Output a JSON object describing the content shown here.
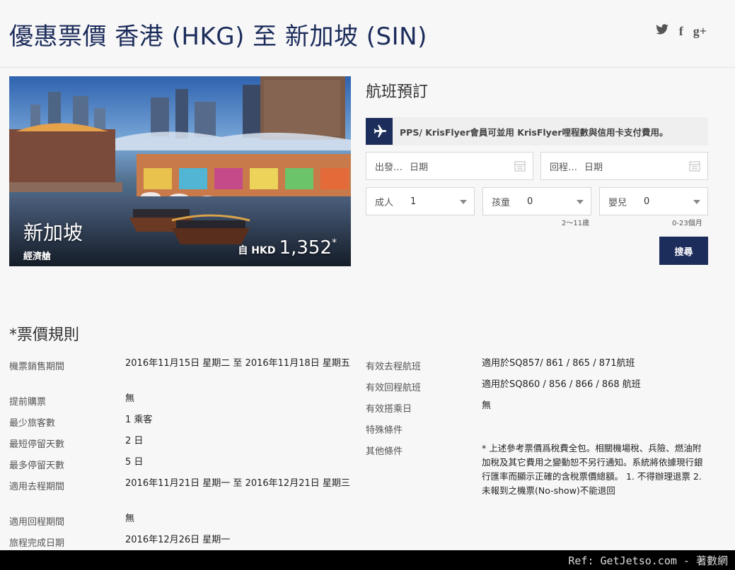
{
  "page": {
    "title": "優惠票價 香港 (HKG) 至 新加坡 (SIN)"
  },
  "social": {
    "twitter": "🐦",
    "facebook": "f",
    "googleplus": "g+"
  },
  "hero": {
    "destination": "新加坡",
    "cabin_class": "經濟艙",
    "price_prefix": "自 HKD",
    "price": "1,352",
    "price_mark": "*"
  },
  "booking": {
    "title": "航班預訂",
    "notice": "PPS/ KrisFlyer會員可並用 KrisFlyer哩程數與信用卡支付費用。",
    "depart_label": "出發…",
    "depart_placeholder": "日期",
    "return_label": "回程…",
    "return_placeholder": "日期",
    "adults_label": "成人",
    "adults_value": "1",
    "children_label": "孩童",
    "children_value": "0",
    "children_hint": "2～11歲",
    "infants_label": "嬰兒",
    "infants_value": "0",
    "infants_hint": "0-23個月",
    "search_label": "搜尋"
  },
  "rules": {
    "title": "*票價規則",
    "left": [
      {
        "label": "機票銷售期間",
        "value": "2016年11月15日 星期二 至 2016年11月18日 星期五"
      },
      {
        "label": "提前購票",
        "value": "無"
      },
      {
        "label": "最少旅客數",
        "value": "1 乘客"
      },
      {
        "label": "最短停留天數",
        "value": "2 日"
      },
      {
        "label": "最多停留天數",
        "value": "5 日"
      },
      {
        "label": "適用去程期間",
        "value": "2016年11月21日 星期一 至 2016年12月21日 星期三"
      },
      {
        "label": "適用回程期間",
        "value": "無"
      },
      {
        "label": "旅程完成日期",
        "value": "2016年12月26日 星期一"
      }
    ],
    "right": [
      {
        "label": "有效去程航班",
        "value": "適用於SQ857/ 861 / 865 / 871航班"
      },
      {
        "label": "有效回程航班",
        "value": "適用於SQ860 / 856 / 866 / 868 航班"
      },
      {
        "label": "有效搭乘日",
        "value": "無"
      },
      {
        "label": "特殊條件",
        "value": ""
      },
      {
        "label": "其他條件",
        "value": "* 上述參考票價爲稅費全包。相關機場稅、兵險、燃油附加稅及其它費用之變動恕不另行通知。系統將依據現行銀行匯率而顯示正確的含稅票價總額。 1. 不得辦理退票 2. 未報到之機票(No-show)不能退回"
      }
    ]
  },
  "footer": {
    "ref": "Ref: GetJetso.com - 著數網"
  }
}
